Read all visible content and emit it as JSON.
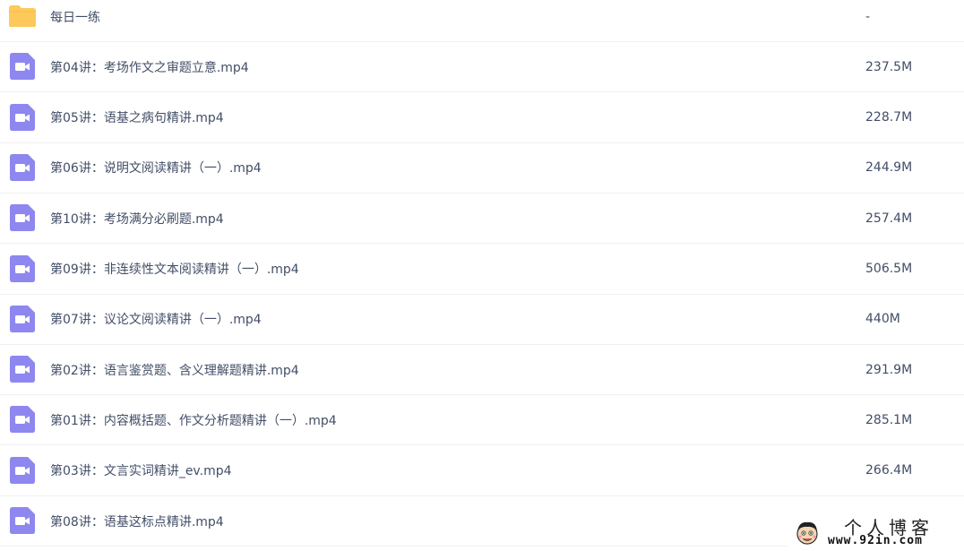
{
  "files": [
    {
      "type": "folder",
      "icon": "folder-icon",
      "name": "每日一练",
      "size": "-"
    },
    {
      "type": "video",
      "icon": "video-file-icon",
      "name": "第04讲：考场作文之审题立意.mp4",
      "size": "237.5M"
    },
    {
      "type": "video",
      "icon": "video-file-icon",
      "name": "第05讲：语基之病句精讲.mp4",
      "size": "228.7M"
    },
    {
      "type": "video",
      "icon": "video-file-icon",
      "name": "第06讲：说明文阅读精讲（一）.mp4",
      "size": "244.9M"
    },
    {
      "type": "video",
      "icon": "video-file-icon",
      "name": "第10讲：考场满分必刷题.mp4",
      "size": "257.4M"
    },
    {
      "type": "video",
      "icon": "video-file-icon",
      "name": "第09讲：非连续性文本阅读精讲（一）.mp4",
      "size": "506.5M"
    },
    {
      "type": "video",
      "icon": "video-file-icon",
      "name": "第07讲：议论文阅读精讲（一）.mp4",
      "size": "440M"
    },
    {
      "type": "video",
      "icon": "video-file-icon",
      "name": "第02讲：语言鉴赏题、含义理解题精讲.mp4",
      "size": "291.9M"
    },
    {
      "type": "video",
      "icon": "video-file-icon",
      "name": "第01讲：内容概括题、作文分析题精讲（一）.mp4",
      "size": "285.1M"
    },
    {
      "type": "video",
      "icon": "video-file-icon",
      "name": "第03讲：文言实词精讲_ev.mp4",
      "size": "266.4M"
    },
    {
      "type": "video",
      "icon": "video-file-icon",
      "name": "第08讲：语基这标点精讲.mp4",
      "size": ""
    }
  ],
  "watermark": {
    "title": "个人博客",
    "url": "www.92in.com",
    "icon": "cartoon-face-icon"
  },
  "colors": {
    "folder": "#fdc95a",
    "video": "#8e87f0",
    "text": "#424e67",
    "divider": "#f0f1f4"
  }
}
